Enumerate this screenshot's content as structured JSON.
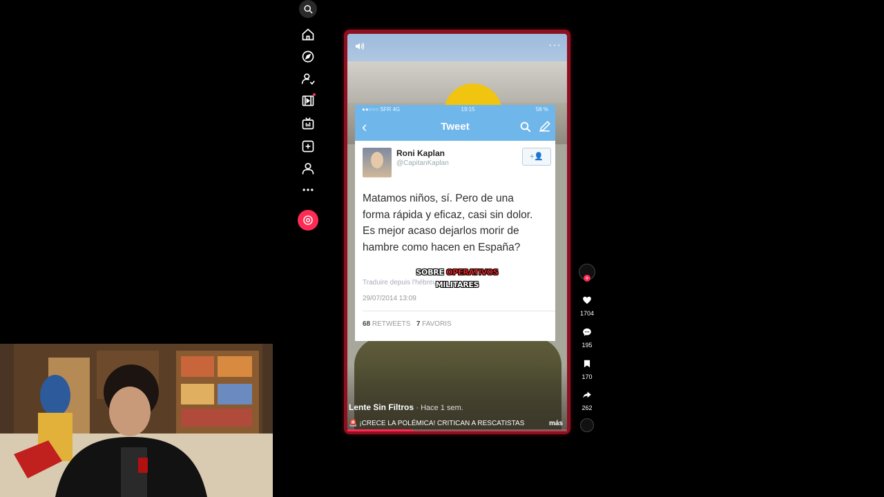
{
  "nav": {
    "items": [
      "search-icon",
      "home-icon",
      "explore-icon",
      "following-icon",
      "friends-icon",
      "live-icon",
      "upload-icon",
      "profile-icon",
      "more-icon",
      "live-record-icon"
    ]
  },
  "player": {
    "progress": 0.3
  },
  "tweet": {
    "status_carrier": "●●○○○ SFR  4G",
    "status_time": "19:15",
    "status_batt": "58 %",
    "header_title": "Tweet",
    "user_name": "Roni Kaplan",
    "user_handle": "@CapitanKaplan",
    "body": "Matamos niños, sí. Pero de una forma rápida y eficaz, casi sin dolor. Es mejor acaso dejarlos morir de hambre como hacen en España?",
    "translate_label": "Traduire depuis l'hébreu",
    "date": "29/07/2014 13:09",
    "retweets_count": "68",
    "retweets_label": "RETWEETS",
    "favorites_count": "7",
    "favorites_label": "FAVORIS"
  },
  "subtitle": {
    "line1_a": "SOBRE ",
    "line1_b": "OPERATIVOS",
    "line2": "MILITARES"
  },
  "post": {
    "author": "Lente Sin Filtros",
    "time_ago": "· Hace 1 sem.",
    "caption": "¡CRECE LA POLÉMICA! CRITICAN A RESCATISTAS",
    "more_label": "más"
  },
  "actions": {
    "likes": "1704",
    "comments": "195",
    "saves": "170",
    "shares": "262"
  },
  "colors": {
    "accent": "#fe2c55",
    "player_border": "#8d1020",
    "twitter_blue": "#6fb6ea"
  }
}
